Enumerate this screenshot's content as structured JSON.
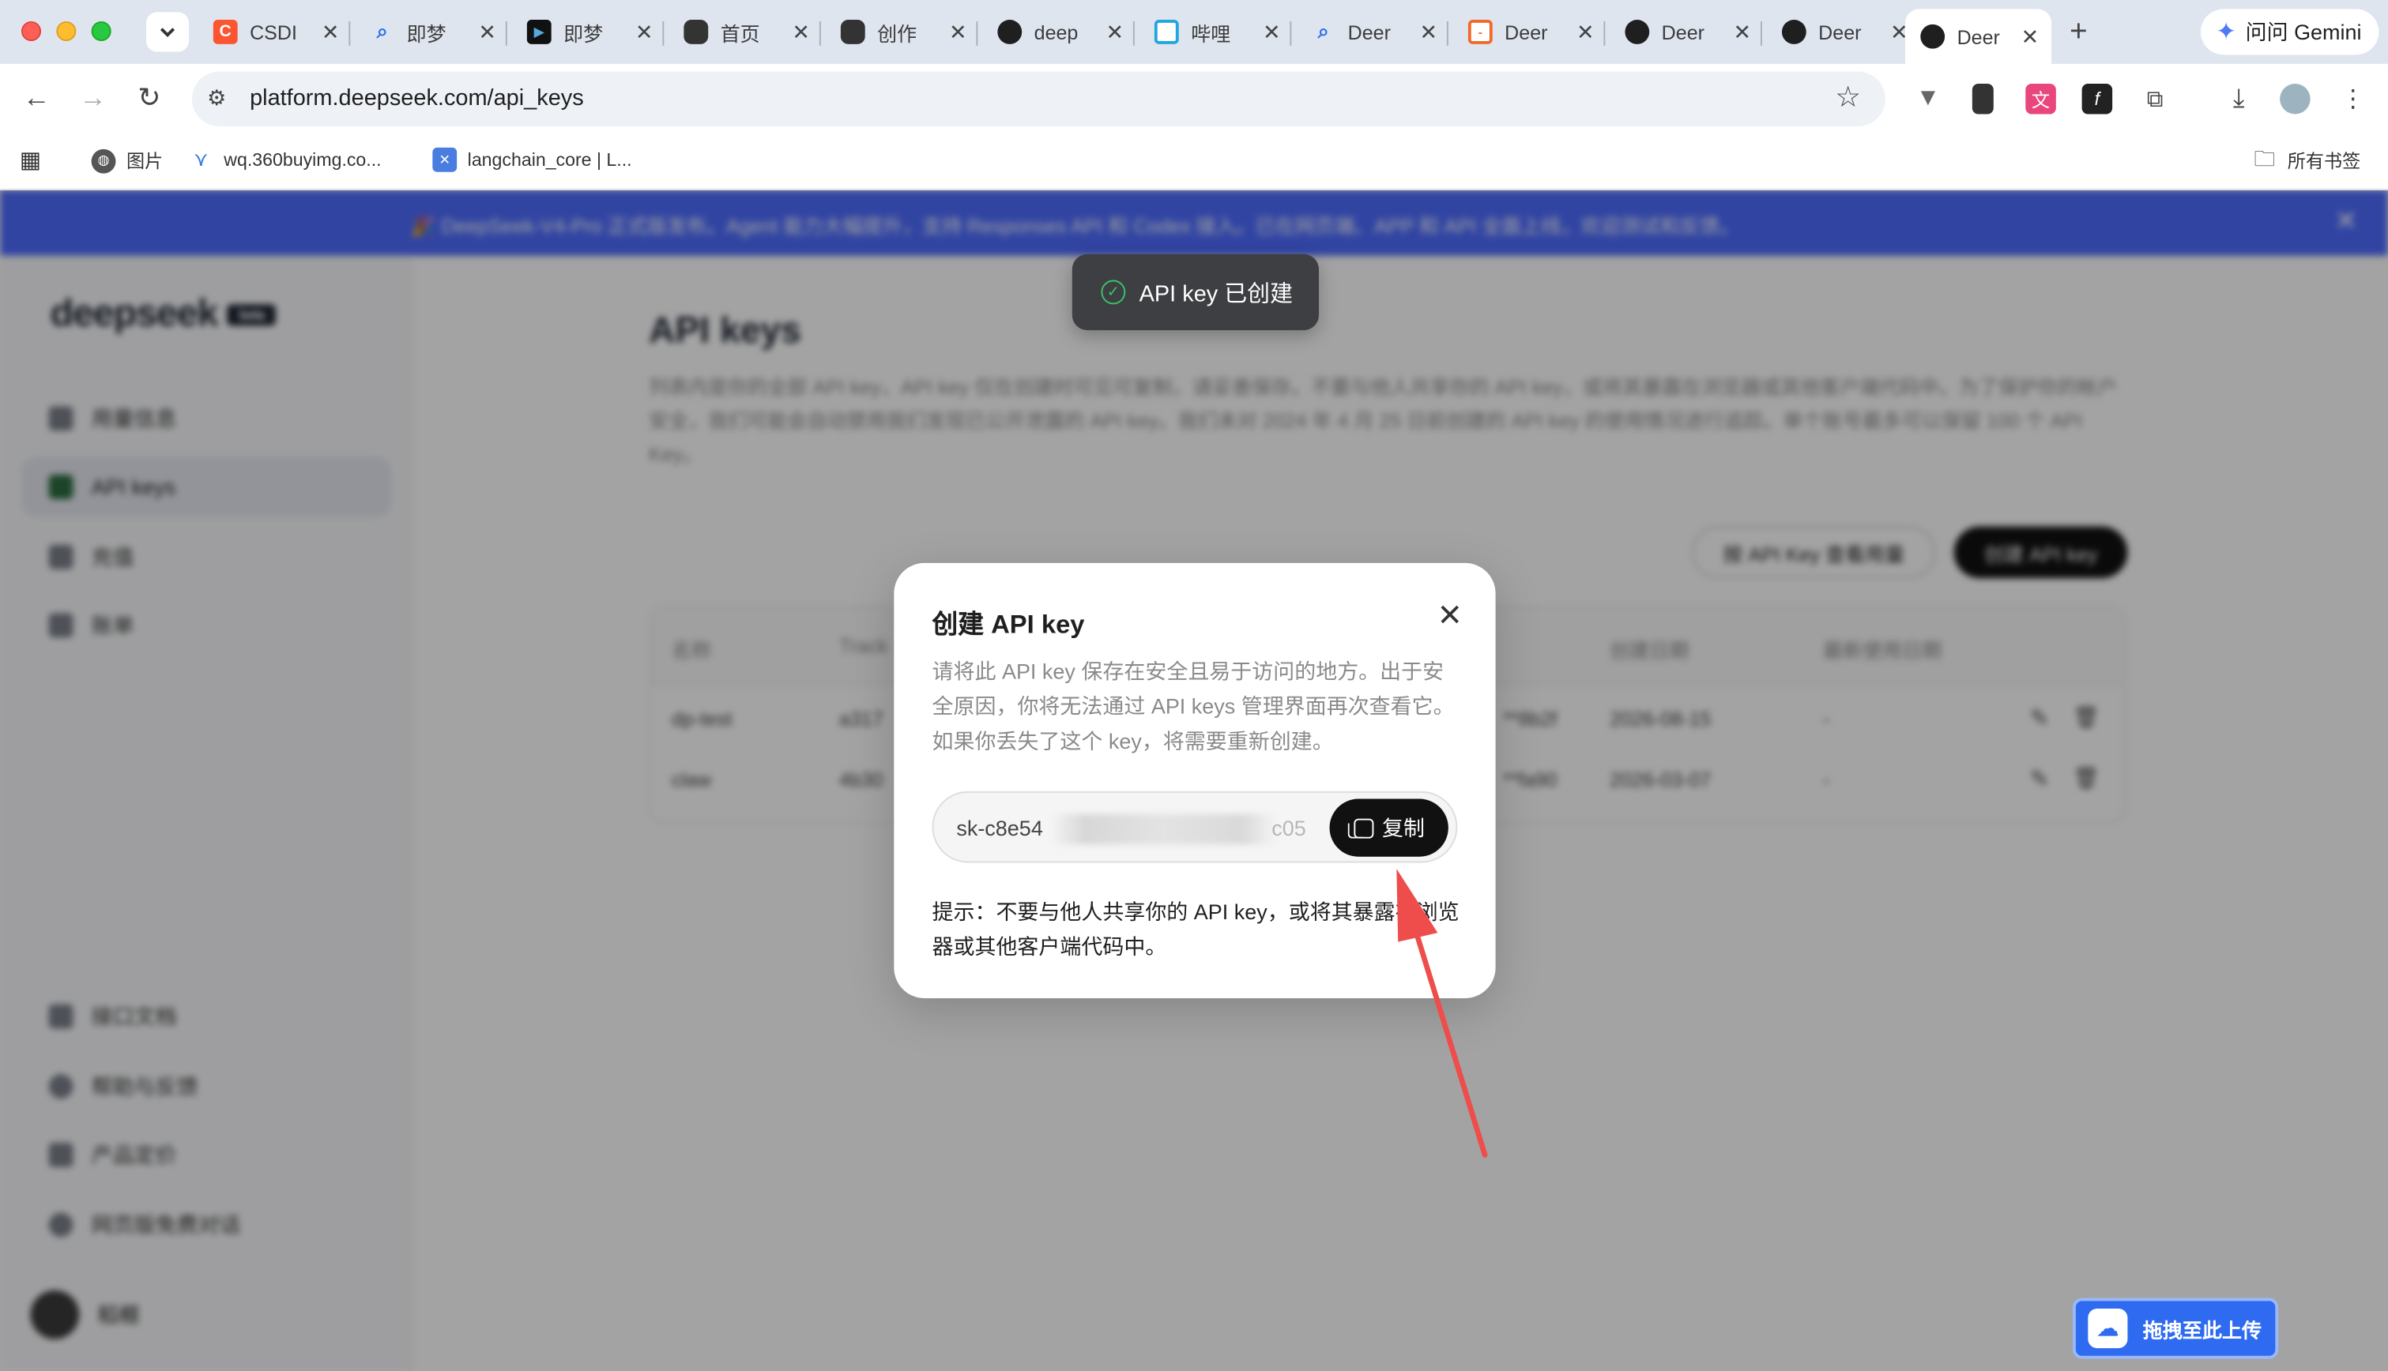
{
  "browser": {
    "tabs": [
      {
        "label": "CSDI",
        "favicon_color": "#fc5531",
        "favicon_char": "C"
      },
      {
        "label": "即梦",
        "favicon_color": "#ffffff",
        "favicon_char": "🔍"
      },
      {
        "label": "即梦",
        "favicon_color": "#111111",
        "favicon_char": "▶"
      },
      {
        "label": "首页",
        "favicon_color": "#ffffff",
        "favicon_char": "🤖"
      },
      {
        "label": "创作",
        "favicon_color": "#ffffff",
        "favicon_char": "🤖"
      },
      {
        "label": "deep",
        "favicon_color": "#ffffff",
        "favicon_char": "gh"
      },
      {
        "label": "哔哩",
        "favicon_color": "#ffffff",
        "favicon_char": "📺"
      },
      {
        "label": "Deer",
        "favicon_color": "#ffffff",
        "favicon_char": "🔍"
      },
      {
        "label": "Deer",
        "favicon_color": "#ffffff",
        "favicon_char": "[-]"
      },
      {
        "label": "Deer",
        "favicon_color": "#ffffff",
        "favicon_char": "🐋"
      },
      {
        "label": "Deer",
        "favicon_color": "#ffffff",
        "favicon_char": "🐋"
      },
      {
        "label": "Deer",
        "favicon_color": "#ffffff",
        "favicon_char": "🐋",
        "active": true
      }
    ],
    "gemini_label": "问问 Gemini",
    "url": "platform.deepseek.com/api_keys",
    "bookmarks": [
      {
        "label": "图片"
      },
      {
        "label": "wq.360buyimg.co..."
      },
      {
        "label": "langchain_core | L..."
      }
    ],
    "all_bookmarks_label": "所有书签"
  },
  "page": {
    "banner_text": "🎉 DeepSeek-V4-Pro 正式版发布。Agent 能力大幅提升，支持 Responses API 和 Codex 接入。已在网页端、APP 和 API 全面上线，欢迎测试和反馈。",
    "logo": "deepseek",
    "logo_badge": "beta",
    "sidebar_items": [
      {
        "label": "用量信息",
        "active": false
      },
      {
        "label": "API keys",
        "active": true
      },
      {
        "label": "充值",
        "active": false
      },
      {
        "label": "账单",
        "active": false
      }
    ],
    "sidebar_bottom": [
      {
        "label": "接口文档"
      },
      {
        "label": "帮助与反馈"
      },
      {
        "label": "产品定价"
      },
      {
        "label": "网页版免费对话"
      }
    ],
    "user_name": "稻榧",
    "title": "API keys",
    "description": "列表内是你的全部 API key，API key 仅在创建时可见可复制，请妥善保存。不要与他人共享你的 API key，或将其暴露在浏览器或其他客户端代码中。为了保护你的帐户安全，我们可能会自动禁用我们发现已公开泄露的 API key。我们未对 2024 年 4 月 25 日前创建的 API key 的使用情况进行追踪。单个账号最多可以保留 100 个 API Key。",
    "btn_usage": "按 API Key 查看用量",
    "btn_create": "创建 API key",
    "table": {
      "headers": [
        "名称",
        "Track",
        "创建日期",
        "最新使用日期"
      ],
      "rows": [
        {
          "name": "dp-test",
          "key": "a317",
          "key_tail": "**8b2f",
          "created": "2026-08-15",
          "last_used": "-"
        },
        {
          "name": "claw",
          "key": "4b30",
          "key_tail": "**fa90",
          "created": "2026-03-07",
          "last_used": "-"
        }
      ]
    }
  },
  "toast": {
    "text": "API key 已创建"
  },
  "modal": {
    "title": "创建 API key",
    "description": "请将此 API key 保存在安全且易于访问的地方。出于安全原因，你将无法通过 API keys 管理界面再次查看它。如果你丢失了这个 key，将需要重新创建。",
    "key_prefix": "sk-c8e54",
    "key_suffix": "c05",
    "copy_label": "复制",
    "tip": "提示：不要与他人共享你的 API key，或将其暴露在浏览器或其他客户端代码中。"
  },
  "upload_widget": {
    "label": "拖拽至此上传"
  },
  "colors": {
    "annotation_arrow": "#ef4c4c",
    "banner": "#4d6bfe",
    "toast_check": "#3ac26a"
  }
}
